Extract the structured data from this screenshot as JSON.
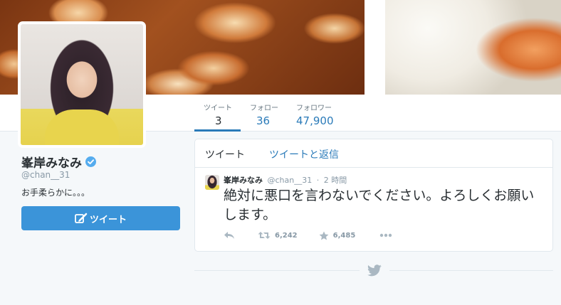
{
  "profile": {
    "name": "峯岸みなみ",
    "handle": "@chan__31",
    "bio": "お手柔らかに。。。",
    "tweet_button_label": "ツイート"
  },
  "nav": {
    "stats": [
      {
        "label": "ツイート",
        "value": "3"
      },
      {
        "label": "フォロー",
        "value": "36"
      },
      {
        "label": "フォロワー",
        "value": "47,900"
      }
    ]
  },
  "timeline": {
    "tabs": [
      {
        "label": "ツイート"
      },
      {
        "label": "ツイートと返信"
      }
    ]
  },
  "tweet": {
    "author": "峯岸みなみ",
    "handle": "@chan__31",
    "separator": "·",
    "time": "2 時間",
    "text": "絶対に悪口を言わないでください。よろしくお願いします。",
    "retweets": "6,242",
    "favorites": "6,485"
  },
  "colors": {
    "accent": "#2b7bb9",
    "button": "#3b94d9",
    "verified": "#55acee"
  },
  "icons": [
    "verified-badge-icon",
    "compose-icon",
    "reply-icon",
    "retweet-icon",
    "favorite-star-icon",
    "more-icon",
    "bird-icon"
  ]
}
